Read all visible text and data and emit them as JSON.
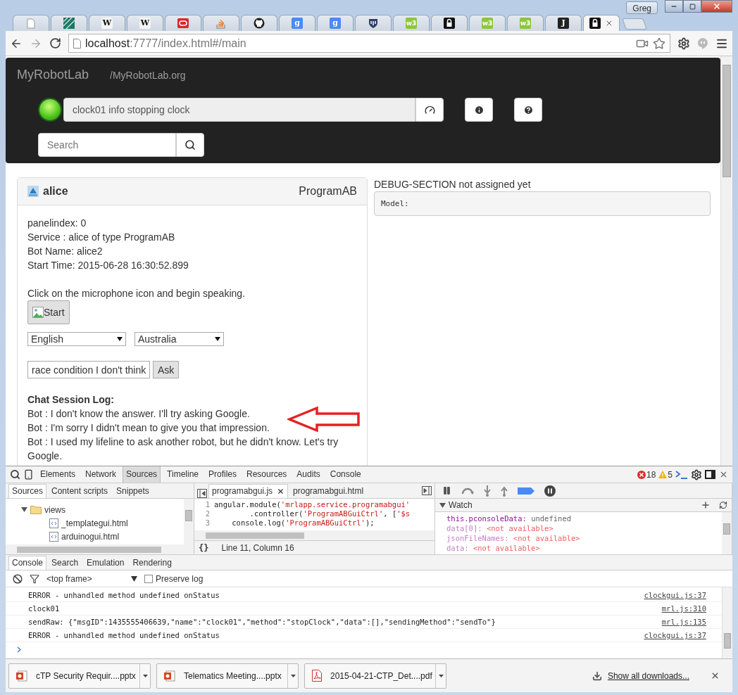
{
  "window": {
    "user": "Greg"
  },
  "tabs": [
    {
      "kind": "page",
      "selected": false
    },
    {
      "kind": "stripes",
      "selected": false
    },
    {
      "kind": "wiki",
      "glyph": "W",
      "selected": false
    },
    {
      "kind": "wiki",
      "glyph": "W",
      "selected": false
    },
    {
      "kind": "oracle",
      "selected": false
    },
    {
      "kind": "stack",
      "selected": false
    },
    {
      "kind": "cat",
      "selected": false
    },
    {
      "kind": "google",
      "glyph": "g",
      "selected": false
    },
    {
      "kind": "google",
      "glyph": "g",
      "selected": false
    },
    {
      "kind": "shield",
      "selected": false
    },
    {
      "kind": "w3",
      "glyph": "w3",
      "selected": false
    },
    {
      "kind": "lock",
      "selected": false
    },
    {
      "kind": "w3",
      "glyph": "w3",
      "selected": false
    },
    {
      "kind": "w3",
      "glyph": "w3",
      "selected": false
    },
    {
      "kind": "j",
      "glyph": "J",
      "selected": false
    },
    {
      "kind": "lock",
      "selected": true
    }
  ],
  "address": {
    "host": "localhost",
    "path": ":7777/index.html#/main"
  },
  "navbar": {
    "brand": "MyRobotLab",
    "link": "/MyRobotLab.org",
    "led_on": true,
    "status": "clock01 info stopping clock",
    "search_placeholder": "Search"
  },
  "panel": {
    "name": "alice",
    "type": "ProgramAB",
    "info": [
      "panelindex: 0",
      "Service : alice of type ProgramAB",
      "Bot Name: alice2",
      "Start Time: 2015-06-28 16:30:52.899"
    ],
    "prompt": "Click on the microphone icon and begin speaking.",
    "start_label": "Start",
    "language": "English",
    "region": "Australia",
    "question": "race condition I don't think",
    "ask_label": "Ask",
    "log_title": "Chat Session Log:",
    "log": [
      "Bot : I don't know the answer. I'll try asking Google.",
      "Bot : I'm sorry I didn't mean to give you that impression.",
      "Bot : I used my lifeline to ask another robot, but he didn't know. Let's try Google."
    ]
  },
  "debug": {
    "title": "DEBUG-SECTION not assigned yet",
    "model": "Model:"
  },
  "devtools": {
    "panels": [
      {
        "label": "Elements",
        "selected": false
      },
      {
        "label": "Network",
        "selected": false
      },
      {
        "label": "Sources",
        "selected": true
      },
      {
        "label": "Timeline",
        "selected": false
      },
      {
        "label": "Profiles",
        "selected": false
      },
      {
        "label": "Resources",
        "selected": false
      },
      {
        "label": "Audits",
        "selected": false
      },
      {
        "label": "Console",
        "selected": false
      }
    ],
    "errors": "18",
    "warnings": "5",
    "navigator": {
      "tabs": [
        {
          "label": "Sources",
          "selected": true
        },
        {
          "label": "Content scripts",
          "selected": false
        },
        {
          "label": "Snippets",
          "selected": false
        }
      ],
      "tree": [
        {
          "label": "views",
          "kind": "folder",
          "expanded": true,
          "children": [
            {
              "label": "_templategui.html",
              "kind": "file"
            },
            {
              "label": "arduinogui.html",
              "kind": "file"
            }
          ]
        }
      ]
    },
    "editor": {
      "tabs": [
        {
          "label": "programabgui.js",
          "selected": true
        },
        {
          "label": "programabgui.html",
          "selected": false
        }
      ],
      "lines": [
        {
          "number": "1",
          "segments": [
            {
              "text": "angular.module(",
              "kind": "plain"
            },
            {
              "text": "'mrlapp.service.programabgui'",
              "kind": "string"
            }
          ]
        },
        {
          "number": "2",
          "segments": [
            {
              "text": "        .controller(",
              "kind": "plain"
            },
            {
              "text": "'ProgramABGuiCtrl'",
              "kind": "string"
            },
            {
              "text": ", [",
              "kind": "plain"
            },
            {
              "text": "'$s",
              "kind": "string"
            }
          ]
        },
        {
          "number": "3",
          "segments": [
            {
              "text": "    console.log(",
              "kind": "plain"
            },
            {
              "text": "'ProgramABGuiCtrl'",
              "kind": "string"
            },
            {
              "text": ");",
              "kind": "plain"
            }
          ]
        }
      ],
      "pretty_print": "{}",
      "cursor": "Line 11, Column 16"
    },
    "watch": {
      "title": "Watch",
      "expanded": true,
      "items": [
        {
          "name": "this.pconsoleData:",
          "value": "undefined",
          "available": true
        },
        {
          "name": "data[0]:",
          "value": "<not available>",
          "available": false
        },
        {
          "name": "jsonFileNames:",
          "value": "<not available>",
          "available": false
        },
        {
          "name": "data:",
          "value": "<not available>",
          "available": false
        }
      ]
    },
    "drawer": {
      "tabs": [
        {
          "label": "Console",
          "selected": true
        },
        {
          "label": "Search",
          "selected": false
        },
        {
          "label": "Emulation",
          "selected": false
        },
        {
          "label": "Rendering",
          "selected": false
        }
      ],
      "context": "<top frame>",
      "preserve_label": "Preserve log",
      "preserve_log": false,
      "messages": [
        {
          "text": "ERROR - unhandled method undefined onStatus",
          "source": "clockgui.js:37"
        },
        {
          "text": "clock01",
          "source": "mrl.js:310"
        },
        {
          "text": "sendRaw: {\"msgID\":1435555406639,\"name\":\"clock01\",\"method\":\"stopClock\",\"data\":[],\"sendingMethod\":\"sendTo\"}",
          "source": "mrl.js:135"
        },
        {
          "text": "ERROR - unhandled method undefined onStatus",
          "source": "clockgui.js:37"
        }
      ]
    }
  },
  "downloads": {
    "items": [
      {
        "kind": "pptx",
        "name": "cTP Security Requir....pptx"
      },
      {
        "kind": "pptx",
        "name": "Telematics Meeting....pptx"
      },
      {
        "kind": "pdf",
        "name": "2015-04-21-CTP_Det....pdf"
      }
    ],
    "show_all": "Show all downloads..."
  }
}
